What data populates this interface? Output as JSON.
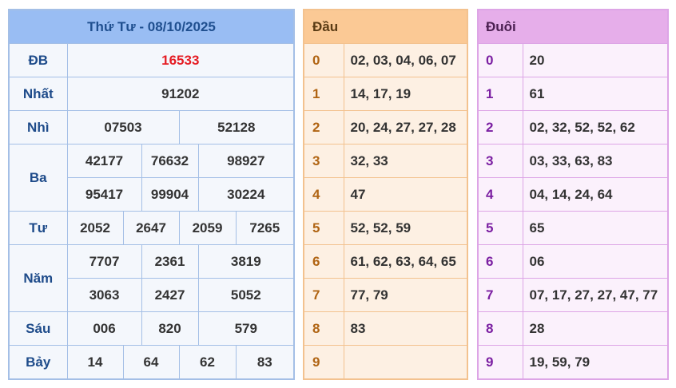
{
  "results": {
    "title": "Thứ Tư - 08/10/2025",
    "rows": {
      "db": {
        "label": "ĐB",
        "values": [
          "16533"
        ]
      },
      "nhat": {
        "label": "Nhất",
        "values": [
          "91202"
        ]
      },
      "nhi": {
        "label": "Nhì",
        "values": [
          "07503",
          "52128"
        ]
      },
      "ba": {
        "label": "Ba",
        "values": [
          "42177",
          "76632",
          "98927",
          "95417",
          "99904",
          "30224"
        ]
      },
      "tu": {
        "label": "Tư",
        "values": [
          "2052",
          "2647",
          "2059",
          "7265"
        ]
      },
      "nam": {
        "label": "Năm",
        "values": [
          "7707",
          "2361",
          "3819",
          "3063",
          "2427",
          "5052"
        ]
      },
      "sau": {
        "label": "Sáu",
        "values": [
          "006",
          "820",
          "579"
        ]
      },
      "bay": {
        "label": "Bảy",
        "values": [
          "14",
          "64",
          "62",
          "83"
        ]
      }
    },
    "special_color": "#e51c23"
  },
  "dau": {
    "header": "Đầu",
    "rows": [
      {
        "digit": "0",
        "values": "02, 03, 04, 06, 07"
      },
      {
        "digit": "1",
        "values": "14, 17, 19"
      },
      {
        "digit": "2",
        "values": "20, 24, 27, 27, 28"
      },
      {
        "digit": "3",
        "values": "32, 33"
      },
      {
        "digit": "4",
        "values": "47"
      },
      {
        "digit": "5",
        "values": "52, 52, 59"
      },
      {
        "digit": "6",
        "values": "61, 62, 63, 64, 65"
      },
      {
        "digit": "7",
        "values": "77, 79"
      },
      {
        "digit": "8",
        "values": "83"
      },
      {
        "digit": "9",
        "values": ""
      }
    ]
  },
  "duoi": {
    "header": "Đuôi",
    "rows": [
      {
        "digit": "0",
        "values": "20"
      },
      {
        "digit": "1",
        "values": "61"
      },
      {
        "digit": "2",
        "values": "02, 32, 52, 52, 62"
      },
      {
        "digit": "3",
        "values": "03, 33, 63, 83"
      },
      {
        "digit": "4",
        "values": "04, 14, 24, 64"
      },
      {
        "digit": "5",
        "values": "65"
      },
      {
        "digit": "6",
        "values": "06"
      },
      {
        "digit": "7",
        "values": "07, 17, 27, 27, 47, 77"
      },
      {
        "digit": "8",
        "values": "28"
      },
      {
        "digit": "9",
        "values": "19, 59, 79"
      }
    ]
  }
}
